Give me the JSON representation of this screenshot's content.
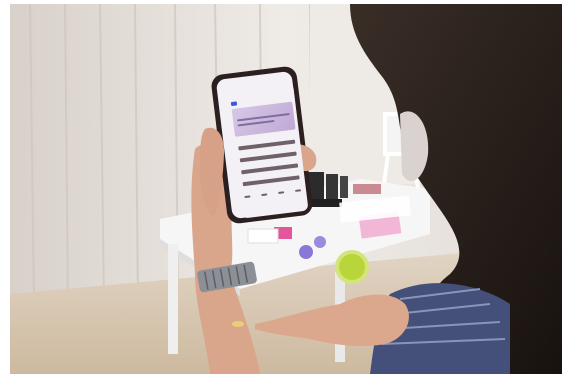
{
  "image": {
    "description_kind": "photograph",
    "scene_elements": [
      "woman-with-dark-hair",
      "smartphone",
      "white-table",
      "equipment",
      "petri-dish",
      "wristwatch",
      "curtain"
    ]
  },
  "colors": {
    "curtain": "#e9e4df",
    "floor": "#d4c3ad",
    "table": "#f6f6f6",
    "hair": "#2a221d",
    "skin": "#d9a58b",
    "sleeve": "#44507a",
    "phone_frame": "#2c1f1f",
    "phone_screen": "#f3f0f6",
    "petri_dish": "#b8d63a"
  }
}
